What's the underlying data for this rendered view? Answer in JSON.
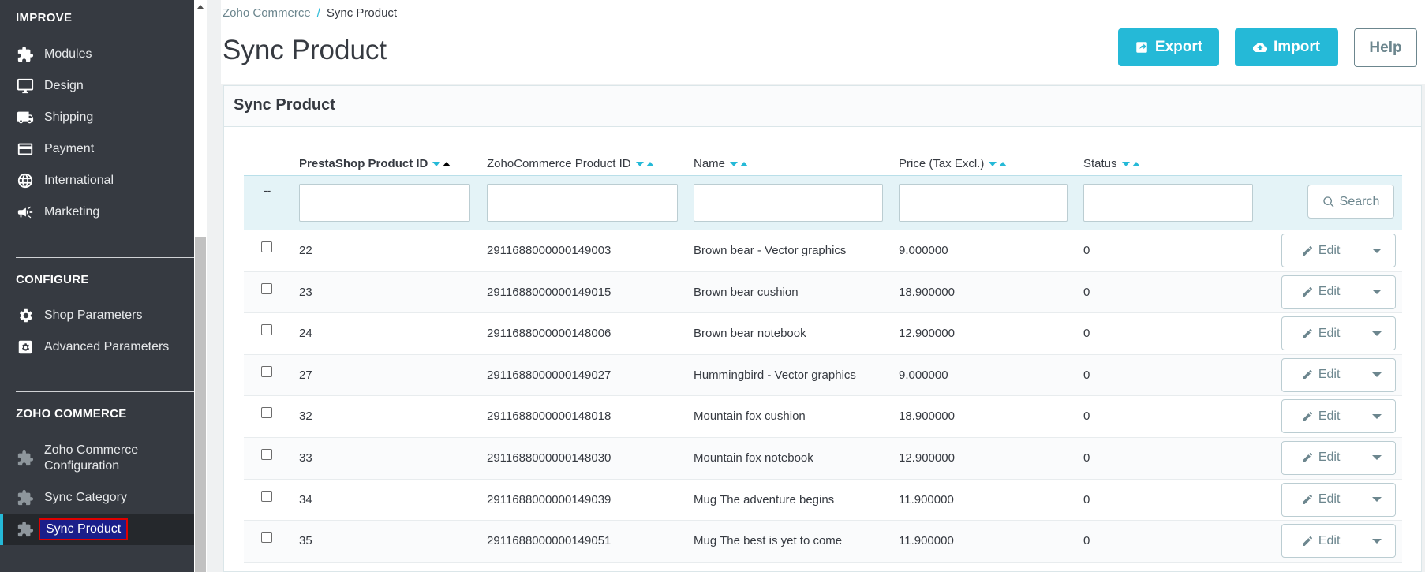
{
  "sidebar": {
    "sections": {
      "improve": "IMPROVE",
      "configure": "CONFIGURE",
      "zoho": "ZOHO COMMERCE"
    },
    "improve_items": [
      {
        "label": "Modules",
        "icon": "puzzle-icon"
      },
      {
        "label": "Design",
        "icon": "monitor-icon"
      },
      {
        "label": "Shipping",
        "icon": "truck-icon"
      },
      {
        "label": "Payment",
        "icon": "card-icon"
      },
      {
        "label": "International",
        "icon": "globe-icon"
      },
      {
        "label": "Marketing",
        "icon": "megaphone-icon"
      }
    ],
    "configure_items": [
      {
        "label": "Shop Parameters",
        "icon": "gear-icon"
      },
      {
        "label": "Advanced Parameters",
        "icon": "cog-box-icon"
      }
    ],
    "zoho_items": [
      {
        "label": "Zoho Commerce Configuration",
        "line1": "Zoho Commerce",
        "line2": "Configuration",
        "icon": "puzzle-icon"
      },
      {
        "label": "Sync Category",
        "icon": "puzzle-icon"
      },
      {
        "label": "Sync Product",
        "icon": "puzzle-icon",
        "active": true
      }
    ]
  },
  "header": {
    "breadcrumb": {
      "parent": "Zoho Commerce",
      "separator": "/",
      "current": "Sync Product"
    },
    "title": "Sync Product",
    "buttons": {
      "export": "Export",
      "import": "Import",
      "help": "Help"
    }
  },
  "panel": {
    "title": "Sync Product",
    "columns": [
      {
        "label": "PrestaShop Product ID",
        "sorted": true
      },
      {
        "label": "ZohoCommerce Product ID"
      },
      {
        "label": "Name"
      },
      {
        "label": "Price (Tax Excl.)"
      },
      {
        "label": "Status"
      }
    ],
    "filter_dash": "--",
    "search_label": "Search",
    "edit_label": "Edit",
    "rows": [
      {
        "id": "22",
        "zoho_id": "2911688000000149003",
        "name": "Brown bear - Vector graphics",
        "price": "9.000000",
        "status": "0"
      },
      {
        "id": "23",
        "zoho_id": "2911688000000149015",
        "name": "Brown bear cushion",
        "price": "18.900000",
        "status": "0"
      },
      {
        "id": "24",
        "zoho_id": "2911688000000148006",
        "name": "Brown bear notebook",
        "price": "12.900000",
        "status": "0"
      },
      {
        "id": "27",
        "zoho_id": "2911688000000149027",
        "name": "Hummingbird - Vector graphics",
        "price": "9.000000",
        "status": "0"
      },
      {
        "id": "32",
        "zoho_id": "2911688000000148018",
        "name": "Mountain fox cushion",
        "price": "18.900000",
        "status": "0"
      },
      {
        "id": "33",
        "zoho_id": "2911688000000148030",
        "name": "Mountain fox notebook",
        "price": "12.900000",
        "status": "0"
      },
      {
        "id": "34",
        "zoho_id": "2911688000000149039",
        "name": "Mug The adventure begins",
        "price": "11.900000",
        "status": "0"
      },
      {
        "id": "35",
        "zoho_id": "2911688000000149051",
        "name": "Mug The best is yet to come",
        "price": "11.900000",
        "status": "0"
      }
    ]
  },
  "colors": {
    "accent": "#25b9d7",
    "sidebar_bg": "#363a41",
    "active_highlight": "#e00000"
  }
}
